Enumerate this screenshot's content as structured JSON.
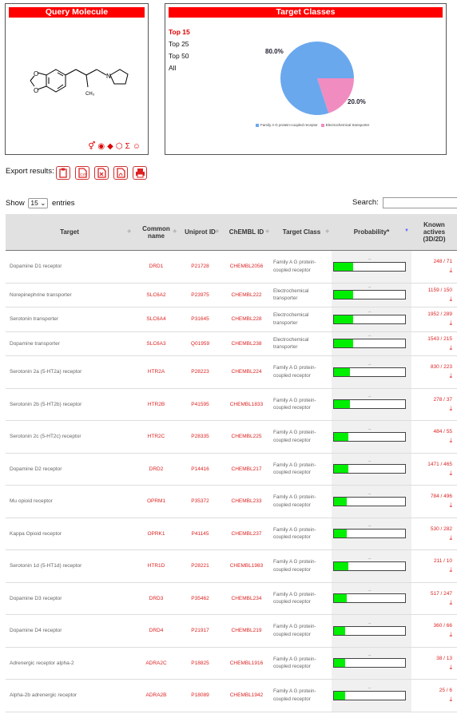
{
  "query": {
    "title": "Query Molecule",
    "icons": [
      "gender-icon",
      "target-icon",
      "pill-icon",
      "hexagon-icon",
      "sigma-icon",
      "smiley-icon"
    ],
    "icon_glyphs": [
      "⚥",
      "◉",
      "◆",
      "⬡",
      "Σ",
      "☺"
    ]
  },
  "targets_panel": {
    "title": "Target Classes",
    "options": [
      "Top 15",
      "Top 25",
      "Top 50",
      "All"
    ],
    "selected": "Top 15",
    "pie": [
      {
        "label": "Family A G protein-coupled receptor",
        "value": 80.0,
        "color": "#6aa8ee",
        "pct_label": "80.0%"
      },
      {
        "label": "Electrochemical transporter",
        "value": 20.0,
        "color": "#f08cc0",
        "pct_label": "20.0%"
      }
    ]
  },
  "export": {
    "label": "Export results:",
    "buttons": [
      "clipboard-icon",
      "csv-icon",
      "excel-icon",
      "pdf-icon",
      "print-icon"
    ]
  },
  "controls": {
    "show": "Show",
    "length": "15",
    "entries": "entries",
    "search": "Search:"
  },
  "headers": {
    "target": "Target",
    "common": "Common name",
    "uniprot": "Uniprot ID",
    "chembl": "ChEMBL ID",
    "class": "Target Class",
    "prob": "Probability*",
    "actives": "Known actives (3D/2D)"
  },
  "rows": [
    {
      "target": "Dopamine D1 receptor",
      "common": "DRD1",
      "uniprot": "P21728",
      "chembl": "CHEMBL2056",
      "cls": "Family A G protein-coupled receptor",
      "prob": 0.27,
      "actives": "248 / 71"
    },
    {
      "target": "Norepinephrine transporter",
      "common": "SLC6A2",
      "uniprot": "P23975",
      "chembl": "CHEMBL222",
      "cls": "Electrochemical transporter",
      "prob": 0.27,
      "actives": "1159 / 150"
    },
    {
      "target": "Serotonin transporter",
      "common": "SLC6A4",
      "uniprot": "P31645",
      "chembl": "CHEMBL228",
      "cls": "Electrochemical transporter",
      "prob": 0.27,
      "actives": "1952 / 289"
    },
    {
      "target": "Dopamine transporter",
      "common": "SLC6A3",
      "uniprot": "Q01959",
      "chembl": "CHEMBL238",
      "cls": "Electrochemical transporter",
      "prob": 0.27,
      "actives": "1543 / 215"
    },
    {
      "target": "Serotonin 2a (5-HT2a) receptor",
      "common": "HTR2A",
      "uniprot": "P28223",
      "chembl": "CHEMBL224",
      "cls": "Family A G protein-coupled receptor",
      "prob": 0.22,
      "actives": "830 / 223"
    },
    {
      "target": "Serotonin 2b (5-HT2b) receptor",
      "common": "HTR2B",
      "uniprot": "P41595",
      "chembl": "CHEMBL1833",
      "cls": "Family A G protein-coupled receptor",
      "prob": 0.22,
      "actives": "278 / 37"
    },
    {
      "target": "Serotonin 2c (5-HT2c) receptor",
      "common": "HTR2C",
      "uniprot": "P28335",
      "chembl": "CHEMBL225",
      "cls": "Family A G protein-coupled receptor",
      "prob": 0.2,
      "actives": "484 / 55"
    },
    {
      "target": "Dopamine D2 receptor",
      "common": "DRD2",
      "uniprot": "P14416",
      "chembl": "CHEMBL217",
      "cls": "Family A G protein-coupled receptor",
      "prob": 0.2,
      "actives": "1471 / 465"
    },
    {
      "target": "Mu opioid receptor",
      "common": "OPRM1",
      "uniprot": "P35372",
      "chembl": "CHEMBL233",
      "cls": "Family A G protein-coupled receptor",
      "prob": 0.18,
      "actives": "784 / 496"
    },
    {
      "target": "Kappa Opioid receptor",
      "common": "OPRK1",
      "uniprot": "P41145",
      "chembl": "CHEMBL237",
      "cls": "Family A G protein-coupled receptor",
      "prob": 0.18,
      "actives": "530 / 282"
    },
    {
      "target": "Serotonin 1d (5-HT1d) receptor",
      "common": "HTR1D",
      "uniprot": "P28221",
      "chembl": "CHEMBL1983",
      "cls": "Family A G protein-coupled receptor",
      "prob": 0.2,
      "actives": "211 / 10"
    },
    {
      "target": "Dopamine D3 receptor",
      "common": "DRD3",
      "uniprot": "P35462",
      "chembl": "CHEMBL234",
      "cls": "Family A G protein-coupled receptor",
      "prob": 0.18,
      "actives": "517 / 247"
    },
    {
      "target": "Dopamine D4 receptor",
      "common": "DRD4",
      "uniprot": "P21917",
      "chembl": "CHEMBL219",
      "cls": "Family A G protein-coupled receptor",
      "prob": 0.16,
      "actives": "360 / 66"
    },
    {
      "target": "Adrenergic receptor alpha-2",
      "common": "ADRA2C",
      "uniprot": "P18825",
      "chembl": "CHEMBL1916",
      "cls": "Family A G protein-coupled receptor",
      "prob": 0.16,
      "actives": "38 / 13"
    },
    {
      "target": "Alpha-2b adrenergic receptor",
      "common": "ADRA2B",
      "uniprot": "P18089",
      "chembl": "CHEMBL1942",
      "cls": "Family A G protein-coupled receptor",
      "prob": 0.16,
      "actives": "25 / 6"
    }
  ]
}
